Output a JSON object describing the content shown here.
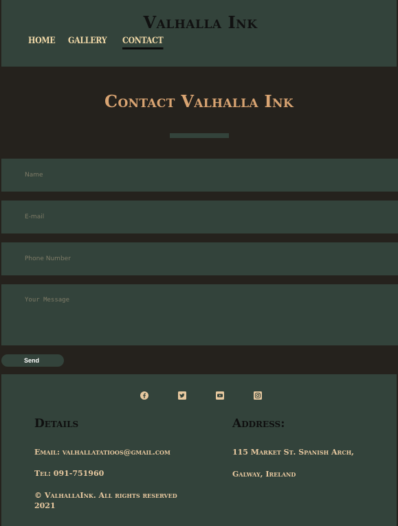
{
  "header": {
    "site_title": "Valhalla Ink",
    "nav": [
      {
        "label": "HOME"
      },
      {
        "label": "GALLERY"
      },
      {
        "label": "CONTACT"
      }
    ]
  },
  "hero": {
    "title": "Contact Valhalla Ink"
  },
  "form": {
    "name_placeholder": "Name",
    "email_placeholder": "E-mail",
    "phone_placeholder": "Phone Number",
    "message_placeholder": "Your Message",
    "send_label": "Send"
  },
  "footer": {
    "socials": [
      {
        "icon": "facebook-icon"
      },
      {
        "icon": "twitter-icon"
      },
      {
        "icon": "youtube-icon"
      },
      {
        "icon": "instagram-icon"
      }
    ],
    "details_heading": "Details",
    "email": "Email: valhallatatioos@gmail.com",
    "tel": "Tel: 091-751960",
    "copyright": "© ValhallaInk. All rights reserved 2021",
    "address_heading": "Address:",
    "address_line1": "115 Market St. Spanish Arch,",
    "address_line2": "Galway, Ireland"
  },
  "colors": {
    "panel": "#33433b",
    "background": "#25221d",
    "accent": "#d9a472",
    "text": "#e8c9a0"
  }
}
